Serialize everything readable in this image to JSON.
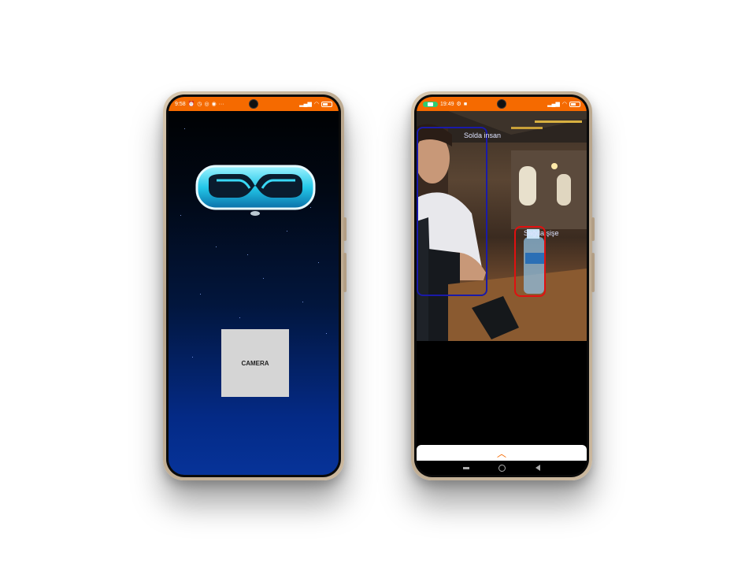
{
  "left_phone": {
    "status_bar": {
      "time": "9:58",
      "icons_left": [
        "alarm-icon",
        "clock-icon",
        "whatsapp-icon",
        "skype-icon",
        "teams-icon",
        "more-icon"
      ],
      "icons_right": [
        "signal-icon",
        "wifi-icon",
        "battery-icon"
      ]
    },
    "camera_button_label": "CAMERA",
    "background_gradient": [
      "#000000",
      "#063399"
    ]
  },
  "right_phone": {
    "status_bar": {
      "time": "19:49",
      "icons_left": [
        "camera-in-use-icon",
        "settings-icon",
        "circle-icon",
        "video-icon"
      ],
      "icons_right": [
        "signal-icon",
        "wifi-icon",
        "battery-icon"
      ]
    },
    "detections": [
      {
        "label": "Solda insan",
        "color": "#1a1aa8"
      },
      {
        "label": "Sağda şişe",
        "color": "#e01010"
      }
    ],
    "bottom_sheet_icon": "chevron-up-icon"
  },
  "colors": {
    "status_bar": "#f56a00",
    "accent": "#f56a00",
    "button_bg": "#d5d5d5"
  }
}
